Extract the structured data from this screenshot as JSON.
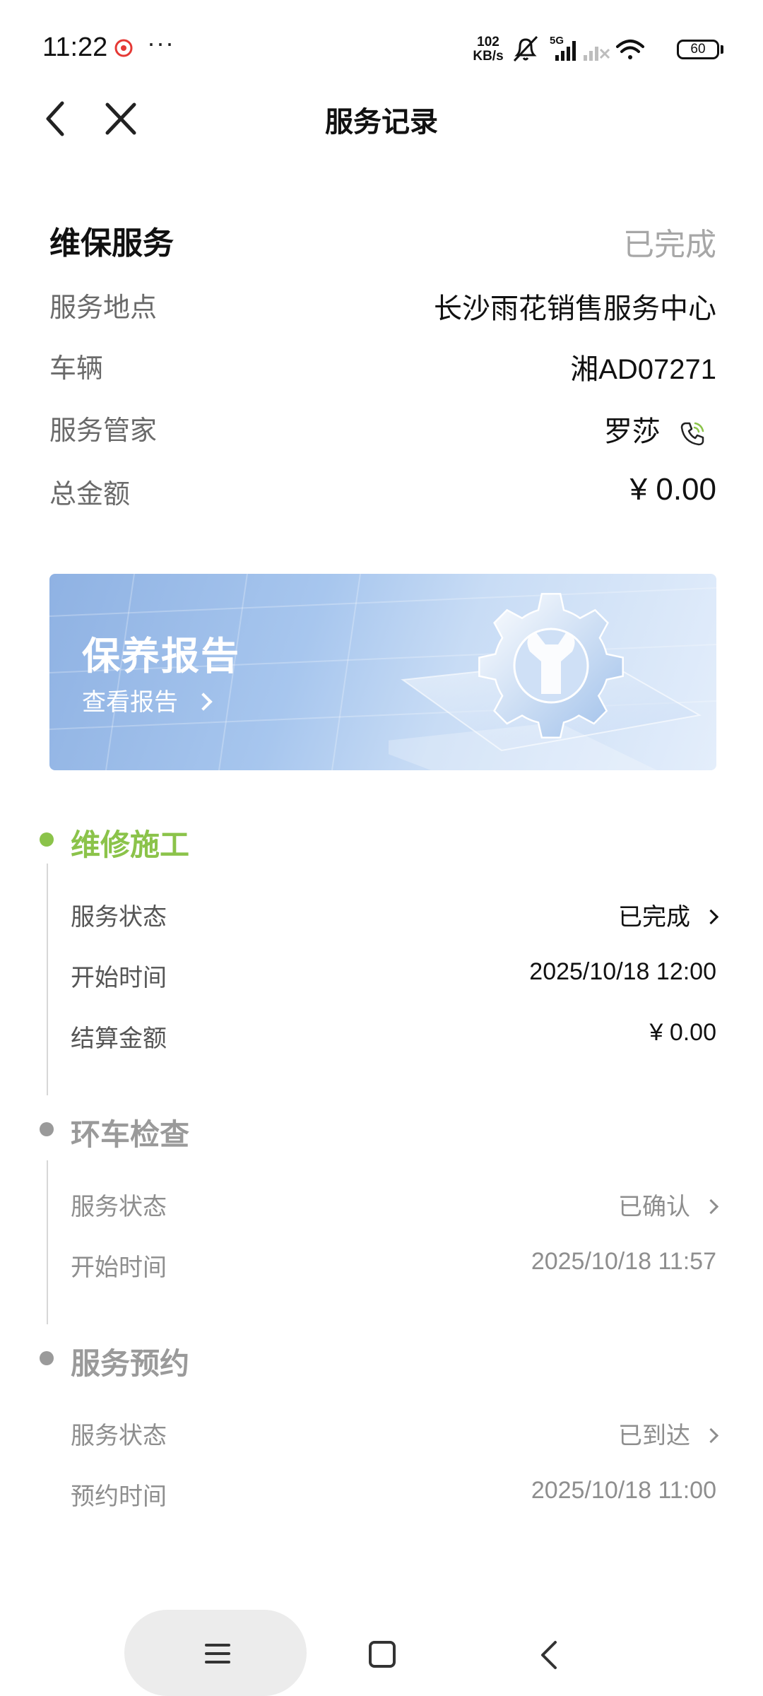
{
  "status_bar": {
    "time": "11:22",
    "more": "···",
    "net_speed_value": "102",
    "net_speed_unit": "KB/s",
    "signal_label": "5G",
    "battery": "60"
  },
  "nav": {
    "title": "服务记录"
  },
  "summary": {
    "service_type": "维保服务",
    "status": "已完成",
    "rows": [
      {
        "label": "服务地点",
        "value": "长沙雨花销售服务中心"
      },
      {
        "label": "车辆",
        "value": "湘AD07271"
      },
      {
        "label": "服务管家",
        "value": "罗莎"
      },
      {
        "label": "总金额",
        "value": "¥ 0.00"
      }
    ]
  },
  "banner": {
    "title": "保养报告",
    "link": "查看报告"
  },
  "timeline": [
    {
      "title": "维修施工",
      "color": "#8bc34a",
      "rows": [
        {
          "label": "服务状态",
          "value": "已完成"
        },
        {
          "label": "开始时间",
          "value": "2025/10/18 12:00"
        },
        {
          "label": "结算金额",
          "value": "¥  0.00"
        }
      ]
    },
    {
      "title": "环车检查",
      "color": "#9a9a9a",
      "rows": [
        {
          "label": "服务状态",
          "value": "已确认"
        },
        {
          "label": "开始时间",
          "value": "2025/10/18 11:57"
        }
      ]
    },
    {
      "title": "服务预约",
      "color": "#9a9a9a",
      "rows": [
        {
          "label": "服务状态",
          "value": "已到达"
        },
        {
          "label": "预约时间",
          "value": "2025/10/18 11:00"
        }
      ]
    }
  ],
  "colors": {
    "accent_green": "#8bc34a",
    "muted_grey": "#9a9a9a"
  }
}
